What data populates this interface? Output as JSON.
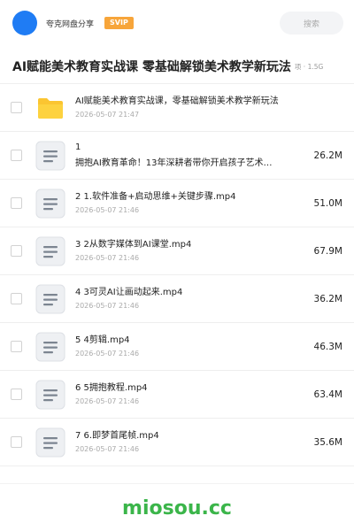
{
  "header": {
    "user_name": "夸克网盘分享",
    "badge": "SVIP",
    "search_placeholder": "搜索"
  },
  "folder": {
    "title": "AI赋能美术教育实战课 零基础解锁美术教学新玩法",
    "meta": "项 · 1.5G"
  },
  "items": [
    {
      "type": "folder",
      "name": "AI赋能美术教育实战课，零基础解锁美术教学新玩法",
      "date": "2026-05-07 21:47",
      "size": ""
    },
    {
      "type": "file",
      "name": "1",
      "name2": "拥抱AI教育革命！13年深耕者带你开启孩子艺术…",
      "date": "2026-05-07 21:46",
      "size": "26.2M"
    },
    {
      "type": "file",
      "name": "2 1.软件准备+启动思维+关键步骤.mp4",
      "date": "2026-05-07 21:46",
      "size": "51.0M"
    },
    {
      "type": "file",
      "name": "3 2从数字媒体到AI课堂.mp4",
      "date": "2026-05-07 21:46",
      "size": "67.9M"
    },
    {
      "type": "file",
      "name": "4 3可灵AI让画动起来.mp4",
      "date": "2026-05-07 21:46",
      "size": "36.2M"
    },
    {
      "type": "file",
      "name": "5 4剪辑.mp4",
      "date": "2026-05-07 21:46",
      "size": "46.3M"
    },
    {
      "type": "file",
      "name": "6 5拥抱教程.mp4",
      "date": "2026-05-07 21:46",
      "size": "63.4M"
    },
    {
      "type": "file",
      "name": "7 6.即梦首尾帧.mp4",
      "date": "2026-05-07 21:46",
      "size": "35.6M"
    }
  ],
  "watermark": "miosou.cc",
  "colors": {
    "accent": "#1f7cf4",
    "svip": "#f7a53a",
    "folder": "#fbc531",
    "watermark": "#3bb54a"
  },
  "icons": {
    "folder": "folder-icon",
    "file": "document-icon"
  }
}
